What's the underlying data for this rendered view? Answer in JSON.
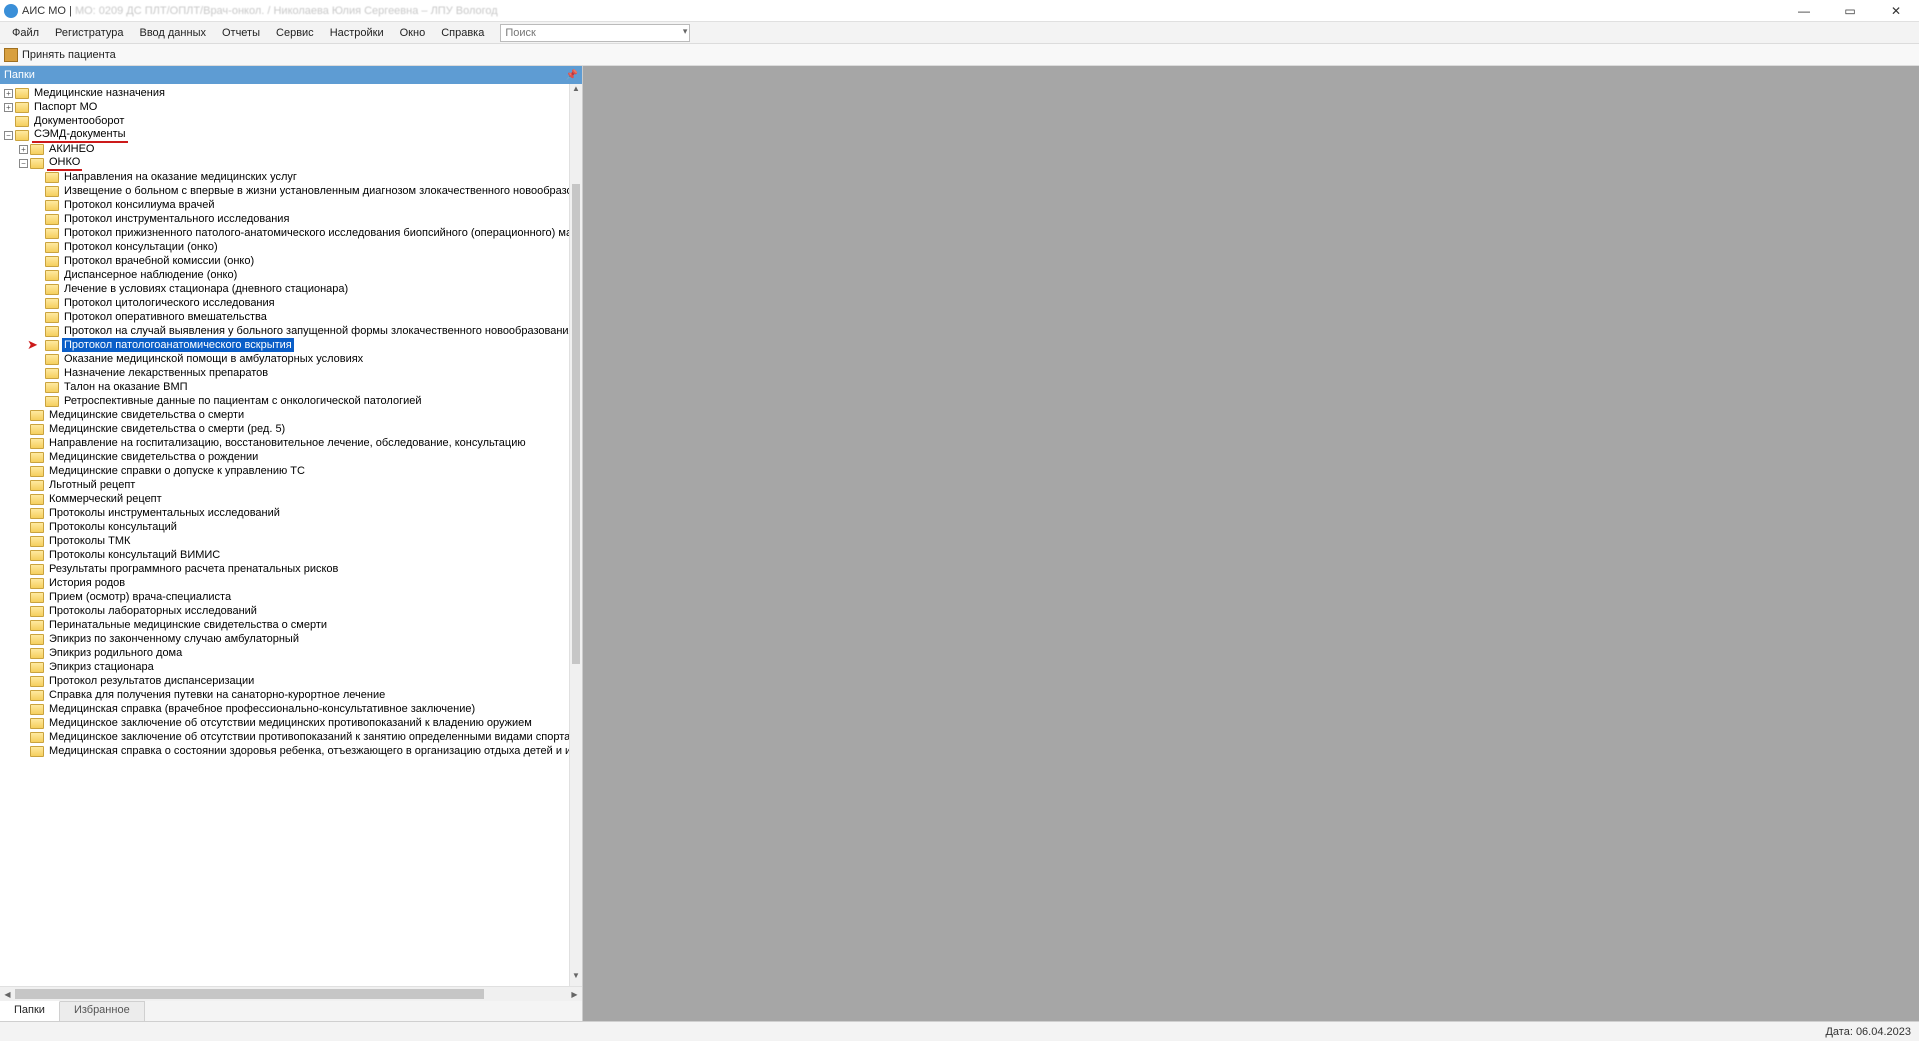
{
  "titlebar": {
    "app_title": "АИС МО | ",
    "context_blur": "МО: 0209 ДС ПЛТ/ОПЛТ/Врач-онкол. / Николаева Юлия Сергеевна – ЛПУ Вологод"
  },
  "menubar": {
    "items": [
      "Файл",
      "Регистратура",
      "Ввод данных",
      "Отчеты",
      "Сервис",
      "Настройки",
      "Окно",
      "Справка"
    ],
    "search_placeholder": "Поиск"
  },
  "toolbar": {
    "accept_patient": "Принять пациента"
  },
  "panel": {
    "title": "Папки"
  },
  "tree": {
    "top": [
      {
        "level": 0,
        "toggle": "+",
        "label": "Медицинские назначения"
      },
      {
        "level": 0,
        "toggle": "+",
        "label": "Паспорт МО"
      },
      {
        "level": 0,
        "toggle": "",
        "label": "Документооборот"
      },
      {
        "level": 0,
        "toggle": "−",
        "label": "СЭМД-документы",
        "underline": true
      },
      {
        "level": 1,
        "toggle": "+",
        "label": "АКИНЕО"
      },
      {
        "level": 1,
        "toggle": "−",
        "label": "ОНКО",
        "underline": true
      }
    ],
    "onko": [
      "Направления на оказание медицинских услуг",
      "Извещение о больном с впервые в жизни установленным диагнозом злокачественного новообразования",
      "Протокол консилиума врачей",
      "Протокол инструментального исследования",
      "Протокол прижизненного патолого-анатомического исследования биопсийного (операционного) материала",
      "Протокол консультации (онко)",
      "Протокол врачебной комиссии (онко)",
      "Диспансерное наблюдение (онко)",
      "Лечение в условиях стационара (дневного стационара)",
      "Протокол цитологического исследования",
      "Протокол оперативного вмешательства",
      "Протокол на случай выявления у больного запущенной формы злокачественного новообразования",
      "Протокол патологоанатомического вскрытия",
      "Оказание медицинской помощи в амбулаторных условиях",
      "Назначение лекарственных препаратов",
      "Талон на оказание ВМП",
      "Ретроспективные данные по пациентам с онкологической патологией"
    ],
    "onko_selected_index": 12,
    "after": [
      "Медицинские свидетельства о смерти",
      "Медицинские свидетельства о смерти (ред. 5)",
      "Направление на госпитализацию, восстановительное лечение, обследование, консультацию",
      "Медицинские свидетельства о рождении",
      "Медицинские справки о допуске к управлению ТС",
      "Льготный рецепт",
      "Коммерческий рецепт",
      "Протоколы инструментальных исследований",
      "Протоколы консультаций",
      "Протоколы ТМК",
      "Протоколы консультаций ВИМИС",
      "Результаты программного расчета пренатальных рисков",
      "История родов",
      "Прием (осмотр) врача-специалиста",
      "Протоколы лабораторных исследований",
      "Перинатальные медицинские свидетельства о смерти",
      "Эпикриз по законченному случаю амбулаторный",
      "Эпикриз родильного дома",
      "Эпикриз стационара",
      "Протокол результатов диспансеризации",
      "Справка для получения путевки на санаторно-курортное лечение",
      "Медицинская справка (врачебное профессионально-консультативное заключение)",
      "Медицинское заключение об отсутствии медицинских противопоказаний к владению оружием",
      "Медицинское заключение об отсутствии противопоказаний к занятию определенными видами спорта",
      "Медицинская справка о состоянии здоровья ребенка, отъезжающего в организацию отдыха детей и их оздоровления"
    ]
  },
  "pane_tabs": {
    "folders": "Папки",
    "favorites": "Избранное"
  },
  "statusbar": {
    "date_label": "Дата: 06.04.2023"
  }
}
